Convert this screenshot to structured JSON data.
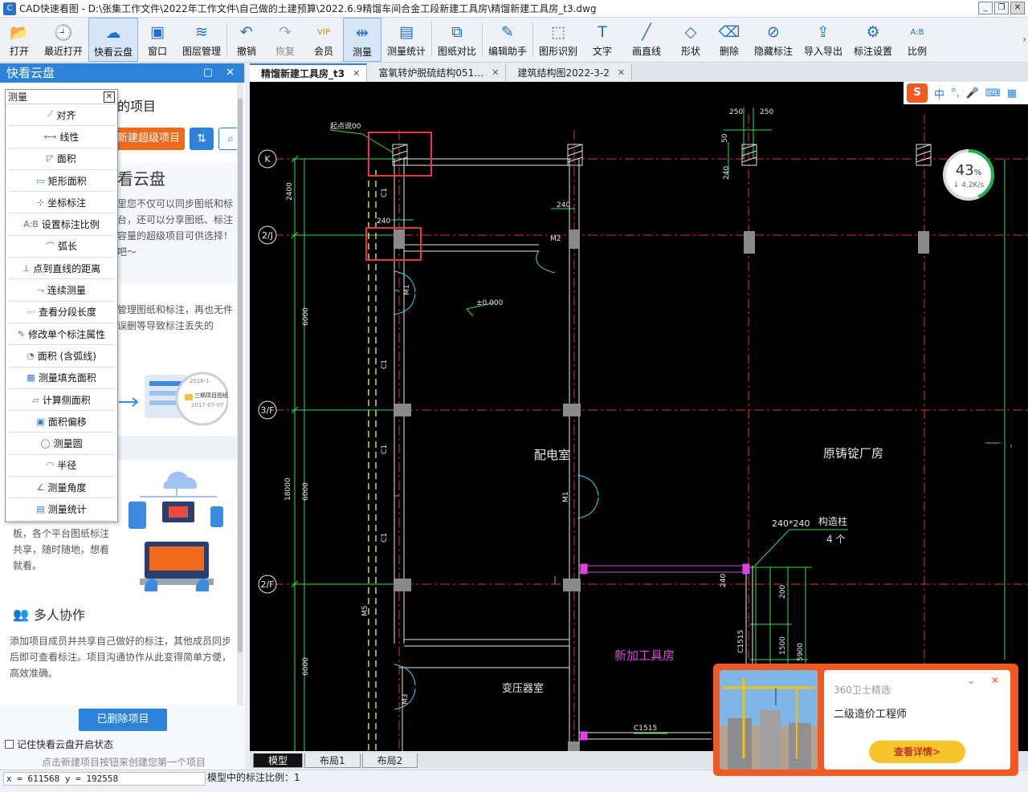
{
  "window": {
    "title": "CAD快速看图 - D:\\张集工作文件\\2022年工作文件\\自己做的土建预算\\2022.6.9精馏车间合金工段新建工具房\\精馏新建工具房_t3.dwg",
    "app_icon": "cad-icon"
  },
  "toolbar": {
    "items": [
      {
        "label": "打开",
        "icon": "folder-open-icon",
        "glyph": "📂"
      },
      {
        "label": "最近打开",
        "icon": "clock-icon",
        "glyph": "🕘"
      },
      {
        "label": "快看云盘",
        "icon": "cloud-icon",
        "glyph": "☁"
      },
      {
        "label": "窗口",
        "icon": "window-icon",
        "glyph": "▣"
      },
      {
        "label": "图层管理",
        "icon": "layers-icon",
        "glyph": "≋"
      },
      {
        "label": "撤销",
        "icon": "undo-icon",
        "glyph": "↶"
      },
      {
        "label": "恢复",
        "icon": "redo-icon",
        "glyph": "↷"
      },
      {
        "label": "会员",
        "icon": "vip-icon",
        "glyph": "VIP"
      },
      {
        "label": "测量",
        "icon": "ruler-icon",
        "glyph": "⇹"
      },
      {
        "label": "测量统计",
        "icon": "stats-icon",
        "glyph": "▤"
      },
      {
        "label": "图纸对比",
        "icon": "compare-icon",
        "glyph": "⧉"
      },
      {
        "label": "编辑助手",
        "icon": "edit-helper-icon",
        "glyph": "✎"
      },
      {
        "label": "图形识别",
        "icon": "shape-recognize-icon",
        "glyph": "⬚"
      },
      {
        "label": "文字",
        "icon": "text-icon",
        "glyph": "T"
      },
      {
        "label": "画直线",
        "icon": "line-icon",
        "glyph": "╱"
      },
      {
        "label": "形状",
        "icon": "shape-icon",
        "glyph": "◇"
      },
      {
        "label": "删除",
        "icon": "eraser-icon",
        "glyph": "⌫"
      },
      {
        "label": "隐藏标注",
        "icon": "eye-hidden-icon",
        "glyph": "⊘"
      },
      {
        "label": "导入导出",
        "icon": "export-icon",
        "glyph": "⇪"
      },
      {
        "label": "标注设置",
        "icon": "settings-icon",
        "glyph": "⚙"
      },
      {
        "label": "比例",
        "icon": "scale-icon",
        "glyph": "A:B"
      }
    ],
    "more": "›"
  },
  "left_panel": {
    "title": "快看云盘",
    "header_buttons": "▢ ✕",
    "project_title": "的项目",
    "new_button": "新建超级项目",
    "sort_glyph": "⇅",
    "search_glyph": "⌕",
    "card1_heading": "看云盘",
    "card1_text": "里您不仅可以同步图纸和标台，还可以分享图纸、标注容量的超级项目可供选择！吧～",
    "card2_text": "管理图纸和标注，再也无件误删等导致标注丢失的",
    "ill1_date1": "2016-1",
    "ill1_name": "三期项目图纸",
    "ill1_date2": "2017-07-07",
    "card3_text": "板，各个平台图纸标注共享，随时随地，想看就看。",
    "collab_heading": "多人协作",
    "collab_text": "添加项目成员并共享自己做好的标注，其他成员同步后即可查看标注。项目沟通协作从此变得简单方便，高效准确。",
    "deleted_button": "已删除项目",
    "remember_label": "记住快看云盘开启状态",
    "hint": "点击新建项目按钮来创建您第一个项目"
  },
  "measure_menu": {
    "title": "测量",
    "close": "✕",
    "items": [
      {
        "label": "对齐",
        "glyph": "⟋"
      },
      {
        "label": "线性",
        "glyph": "⟷"
      },
      {
        "label": "面积",
        "glyph": "◸"
      },
      {
        "label": "矩形面积",
        "glyph": "▭"
      },
      {
        "label": "坐标标注",
        "glyph": "⊹"
      },
      {
        "label": "设置标注比例",
        "glyph": "A:B"
      },
      {
        "label": "弧长",
        "glyph": "⌒"
      },
      {
        "label": "点到直线的距离",
        "glyph": "⊥"
      },
      {
        "label": "连续测量",
        "glyph": "⤳"
      },
      {
        "label": "查看分段长度",
        "glyph": "⋯"
      },
      {
        "label": "修改单个标注属性",
        "glyph": "✎"
      },
      {
        "label": "面积 (含弧线)",
        "glyph": "◔"
      },
      {
        "label": "测量填充面积",
        "glyph": "▦"
      },
      {
        "label": "计算侧面积",
        "glyph": "▱"
      },
      {
        "label": "面积偏移",
        "glyph": "▣"
      },
      {
        "label": "测量圆",
        "glyph": "◯"
      },
      {
        "label": "半径",
        "glyph": "◠"
      },
      {
        "label": "测量角度",
        "glyph": "∠"
      },
      {
        "label": "测量统计",
        "glyph": "▤"
      }
    ]
  },
  "tabs": [
    {
      "label": "精馏新建工具房_t3",
      "active": true
    },
    {
      "label": "富氧转炉脱硫结构051…",
      "active": false
    },
    {
      "label": "建筑结构图2022-3-2",
      "active": false
    }
  ],
  "tab_close": "✕",
  "ime": {
    "logo": "S",
    "lang": "中",
    "punct": "°,",
    "mic": "🎤",
    "keyboard": "⌨",
    "grid": "▦"
  },
  "speed_widget": {
    "percent": 43,
    "percent_text": "43",
    "unit": "%",
    "rate": "↓ 4.2K/s"
  },
  "drawing": {
    "axes": [
      "K",
      "2/J",
      "3/F",
      "2/F"
    ],
    "room_labels": [
      "配电室",
      "原铸锭厂房",
      "新加工具房",
      "变压器室"
    ],
    "dims": [
      "250",
      "250",
      "50",
      "240",
      "240",
      "240",
      "2400",
      "6000",
      "6000",
      "18000",
      "6000",
      "240",
      "200",
      "1500",
      "5900",
      "240",
      "C1515",
      "C1515",
      "C1",
      "C1",
      "C1",
      "C1",
      "M2",
      "M1",
      "M1",
      "M3",
      "M5"
    ],
    "callout_top": "起点说00",
    "elev": "±0.000",
    "column_note": "240*240",
    "column_note2": "构造柱",
    "column_count": "4 个"
  },
  "layout_tabs": [
    "模型",
    "布局1",
    "布局2"
  ],
  "status": {
    "coords": "x = 611568  y = 192558",
    "scale_text": "模型中的标注比例：1"
  },
  "ad": {
    "source": "360卫士精选",
    "title": "二级造价工程师",
    "button": "查看详情>",
    "controls": "⌄ ✕"
  }
}
